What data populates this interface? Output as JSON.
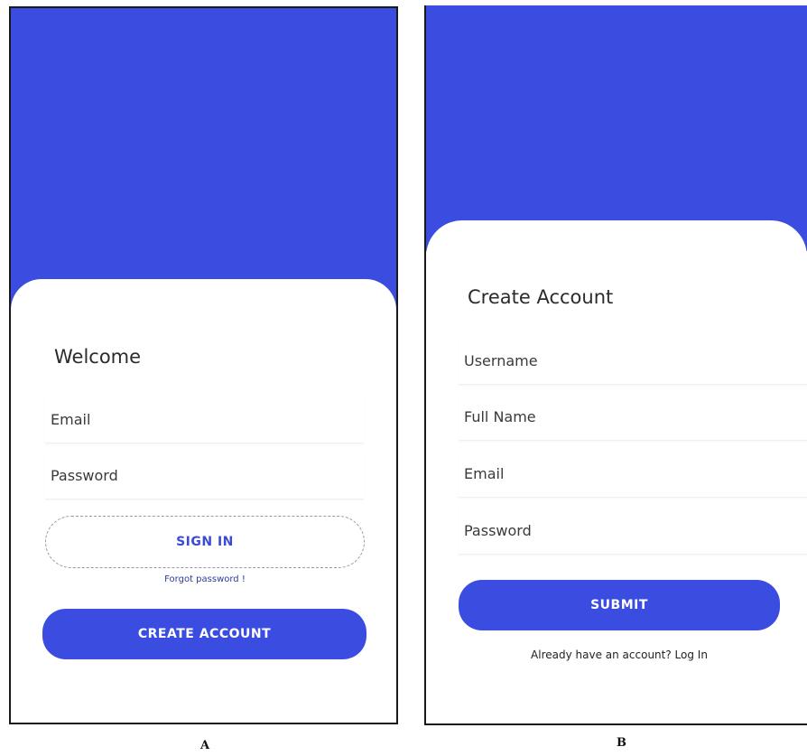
{
  "colors": {
    "brand_blue": "#3b4de0",
    "sheet": "#ffffff",
    "text": "#2b2b2b"
  },
  "screen_a": {
    "heading": "Welcome",
    "email_placeholder": "Email",
    "password_placeholder": "Password",
    "signin_label": "SIGN IN",
    "forgot_label": "Forgot password !",
    "create_label": "CREATE ACCOUNT",
    "caption": "A"
  },
  "screen_b": {
    "heading": "Create Account",
    "username_placeholder": "Username",
    "fullname_placeholder": "Full Name",
    "email_placeholder": "Email",
    "password_placeholder": "Password",
    "submit_label": "SUBMIT",
    "login_prompt": "Already have an account? Log In",
    "caption": "B"
  }
}
